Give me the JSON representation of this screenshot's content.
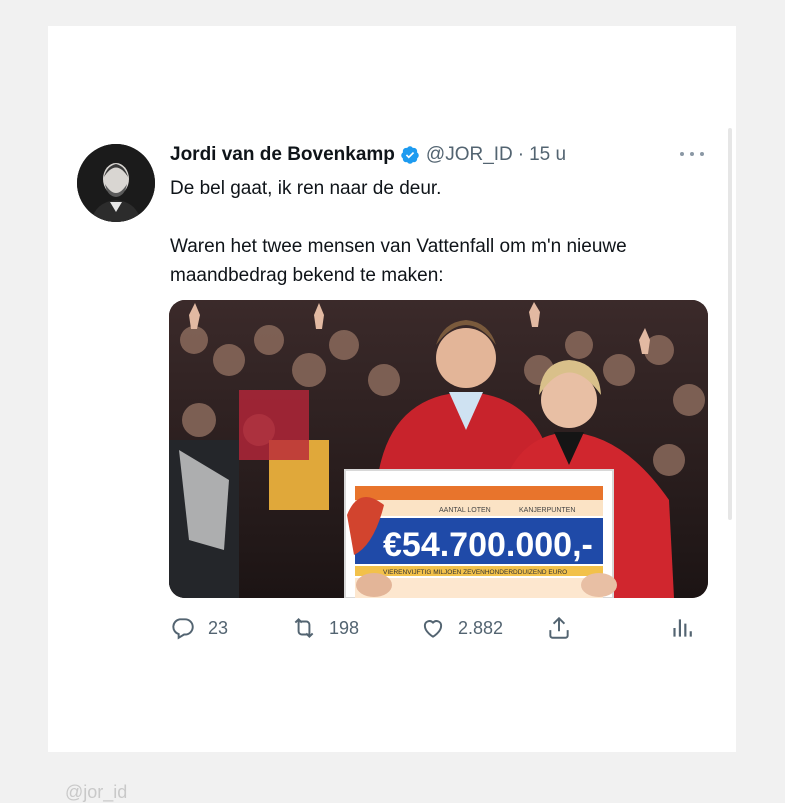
{
  "tweet": {
    "author_name": "Jordi van de Bovenkamp",
    "handle": "@JOR_ID",
    "separator": "·",
    "time": "15 u",
    "verified": true,
    "text_lines": [
      "De bel gaat, ik ren naar de deur.",
      "Waren het twee mensen van Vattenfall om m'n nieuwe maandbedrag bekend te maken:"
    ],
    "media": {
      "check_amount": "€54.700.000,-",
      "check_label_left": "AANTAL LOTEN",
      "check_label_right": "KANJERPUNTEN",
      "check_words": "VIERENVIJFTIG MILJOEN ZEVENHONDERDDUIZEND EURO"
    },
    "actions": {
      "replies": "23",
      "retweets": "198",
      "likes": "2.882"
    }
  },
  "colors": {
    "text_primary": "#0f1419",
    "text_secondary": "#536471",
    "verified_blue": "#1d9bf0"
  },
  "icons": [
    "more-icon",
    "verified-badge-icon",
    "reply-icon",
    "retweet-icon",
    "like-icon",
    "share-icon",
    "analytics-icon"
  ],
  "watermark": "@jor_id"
}
